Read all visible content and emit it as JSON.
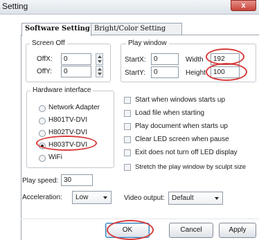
{
  "window": {
    "title": "Setting",
    "close_label": "x"
  },
  "tabs": [
    {
      "label": "Software Setting",
      "active": true
    },
    {
      "label": "Bright/Color Setting",
      "active": false
    }
  ],
  "screen_off": {
    "legend": "Screen Off",
    "offx_label": "OffX:",
    "offx_value": "0",
    "offy_label": "OffY:",
    "offy_value": "0"
  },
  "play_window": {
    "legend": "Play window",
    "startx_label": "StartX:",
    "startx_value": "0",
    "starty_label": "StartY:",
    "starty_value": "0",
    "width_label": "Width",
    "width_value": "192",
    "height_label": "Height",
    "height_value": "100"
  },
  "hardware_interface": {
    "legend": "Hardware interface",
    "options": [
      {
        "label": "Network Adapter",
        "selected": false
      },
      {
        "label": "H801TV-DVI",
        "selected": false
      },
      {
        "label": "H802TV-DVI",
        "selected": false
      },
      {
        "label": "H803TV-DVI",
        "selected": true
      },
      {
        "label": "WiFi",
        "selected": false
      }
    ]
  },
  "options": [
    {
      "label": "Start when windows starts up",
      "checked": false
    },
    {
      "label": "Load file when starting",
      "checked": false
    },
    {
      "label": "Play document when starts up",
      "checked": false
    },
    {
      "label": "Clear LED screen when pause",
      "checked": false
    },
    {
      "label": "Exit does not turn off LED display",
      "checked": false
    },
    {
      "label": "Stretch the play window by  sculpt size",
      "checked": false
    }
  ],
  "play_speed": {
    "label": "Play speed:",
    "value": "30"
  },
  "acceleration": {
    "label": "Acceleration:",
    "value": "Low"
  },
  "video_output": {
    "label": "Video output:",
    "value": "Default"
  },
  "buttons": {
    "ok": "OK",
    "cancel": "Cancel",
    "apply": "Apply"
  },
  "colors": {
    "highlight_ring": "#d93a3a",
    "title_bar": "#dde3ea",
    "close_button": "#c8443a"
  },
  "icons": {
    "close": "close-icon",
    "spin": "spin-arrows-icon",
    "dropdown": "chevron-down-icon"
  }
}
